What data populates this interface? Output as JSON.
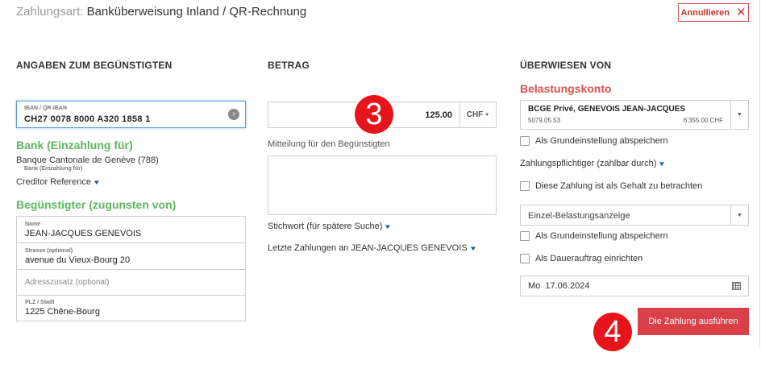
{
  "header": {
    "title_label": "Zahlungsart:",
    "title_value": "Banküberweisung Inland / QR-Rechnung",
    "cancel_label": "Annullieren",
    "cancel_icon": "close-icon"
  },
  "beneficiary": {
    "section_title": "ANGABEN ZUM BEGÜNSTIGTEN",
    "iban_label": "IBAN / QR-IBAN",
    "iban_value": "CH27 0078 8000 A320 1858 1",
    "bank_heading": "Bank (Einzahlung für)",
    "bank_name": "Banque Cantonale de Genève (788)",
    "bank_sublabel": "Bank (Einzahlung für)",
    "creditor_reference": "Creditor Reference",
    "beneficiary_heading": "Begünstigter (zugunsten von)",
    "fields": {
      "name_label": "Name",
      "name_value": "JEAN-JACQUES GENEVOIS",
      "street_label": "Strasse (optional)",
      "street_value": "avenue du Vieux-Bourg 20",
      "address_extra_placeholder": "Adresszusatz (optional)",
      "zip_label": "PLZ / Stadt",
      "zip_value": "1225 Chêne-Bourg"
    }
  },
  "amount": {
    "section_title": "BETRAG",
    "value": "125.00",
    "currency": "CHF",
    "message_label": "Mitteilung für den Begünstigten",
    "keyword_label": "Stichwort (für spätere Suche)",
    "last_payments_label": "Letzte Zahlungen an JEAN-JACQUES GENEVOIS"
  },
  "transfer_from": {
    "section_title": "ÜBERWIESEN VON",
    "debit_heading": "Belastungskonto",
    "account_name": "BCGE Privé, GENEVOIS JEAN-JACQUES",
    "account_number": "5079.05.53",
    "account_balance": "6'355.00 CHF",
    "save_default_1": "Als Grundeinstellung abspeichern",
    "payer_label": "Zahlungspflichtiger (zahlbar durch)",
    "salary_label": "Diese Zahlung ist als Gehalt zu betrachten",
    "debit_display": "Einzel-Belastungsanzeige",
    "save_default_2": "Als Grundeinstellung abspeichern",
    "standing_order_label": "Als Dauerauftrag einrichten",
    "date_value": "Mo  17.06.2024",
    "execute_label": "Die Zahlung ausführen"
  },
  "markers": {
    "step3": "3",
    "step4": "4"
  },
  "colors": {
    "accent_green": "#5cb85c",
    "accent_red": "#d9534f",
    "button_red": "#d9404a",
    "marker_red": "#e8141b",
    "focus_blue": "#5b9bd5"
  }
}
